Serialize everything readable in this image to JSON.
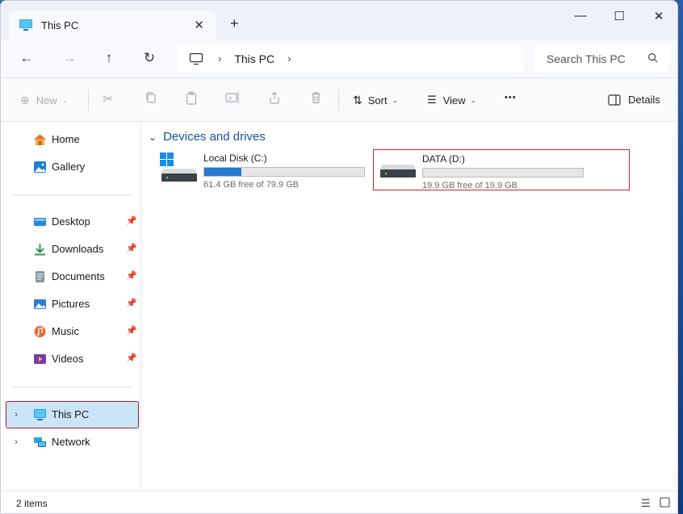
{
  "window": {
    "tab_title": "This PC",
    "tab_close": "✕",
    "new_tab": "+",
    "minimize": "—",
    "maximize": "☐",
    "close": "✕"
  },
  "nav": {
    "back": "←",
    "forward": "→",
    "up": "↑",
    "refresh": "↻"
  },
  "address": {
    "sep": "›",
    "crumb": "This PC",
    "sep_trailing": "›"
  },
  "search": {
    "placeholder": "Search This PC"
  },
  "toolbar": {
    "new_label": "New",
    "sort_label": "Sort",
    "view_label": "View",
    "more_label": "•••",
    "details_label": "Details"
  },
  "sidebar": {
    "top": [
      {
        "label": "Home"
      },
      {
        "label": "Gallery"
      }
    ],
    "pinned": [
      {
        "label": "Desktop"
      },
      {
        "label": "Downloads"
      },
      {
        "label": "Documents"
      },
      {
        "label": "Pictures"
      },
      {
        "label": "Music"
      },
      {
        "label": "Videos"
      }
    ],
    "bottom": [
      {
        "label": "This PC",
        "selected": true
      },
      {
        "label": "Network"
      }
    ]
  },
  "content": {
    "group_title": "Devices and drives",
    "drives": [
      {
        "name": "Local Disk (C:)",
        "free_text": "61.4 GB free of 79.9 GB",
        "used_fraction": 0.23
      },
      {
        "name": "DATA (D:)",
        "free_text": "19.9 GB free of 19.9 GB",
        "used_fraction": 0.0
      }
    ]
  },
  "status": {
    "item_count": "2 items"
  },
  "colors": {
    "accent": "#2678d2",
    "selection_bg": "#cce4f7",
    "highlight_border": "#c8252d",
    "group_header": "#1b4fa0"
  }
}
